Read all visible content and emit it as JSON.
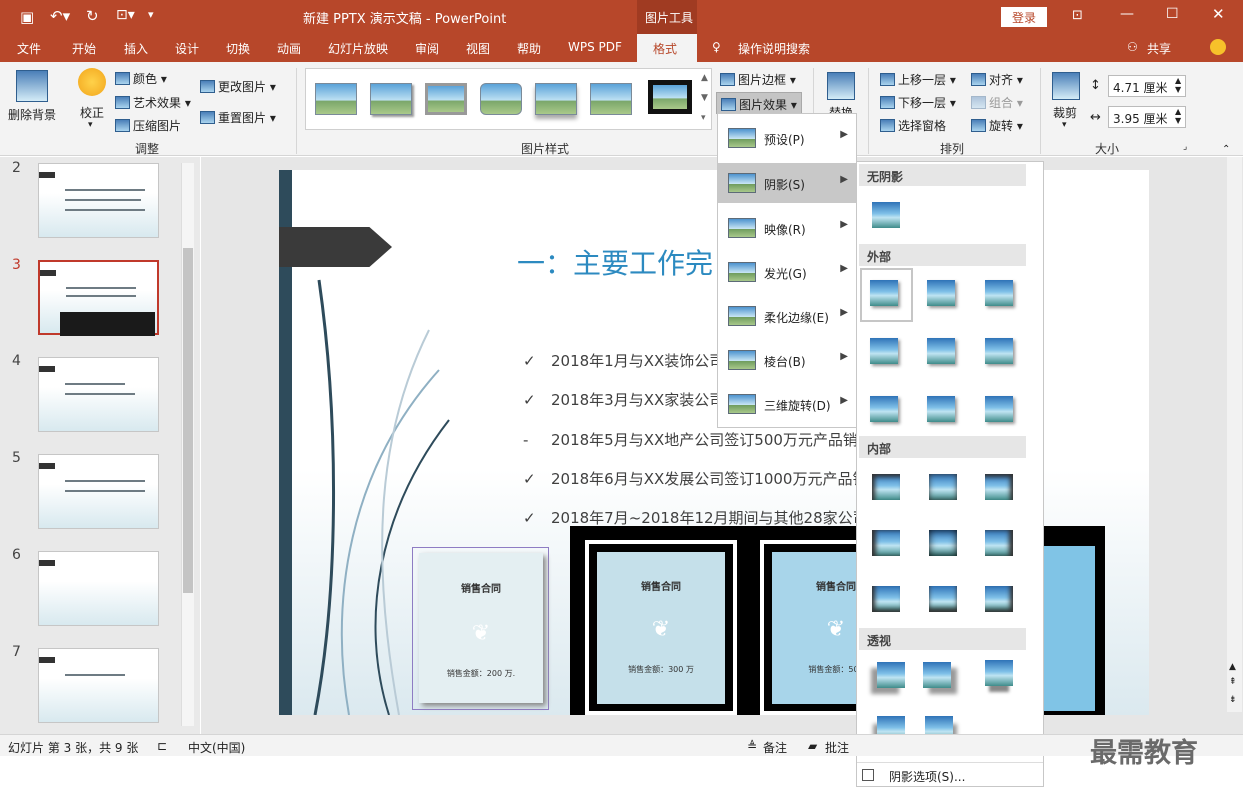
{
  "title": {
    "doc": "新建 PPTX 演示文稿 - PowerPoint",
    "tools": "图片工具",
    "login": "登录"
  },
  "tabs": [
    "文件",
    "开始",
    "插入",
    "设计",
    "切换",
    "动画",
    "幻灯片放映",
    "审阅",
    "视图",
    "帮助",
    "WPS PDF",
    "格式"
  ],
  "tell_me": "操作说明搜索",
  "share": "共享",
  "ribbon": {
    "remove_bg": "删除背景",
    "correct": "校正",
    "color": "颜色",
    "artistic": "艺术效果",
    "compress": "压缩图片",
    "change": "更改图片",
    "reset": "重置图片",
    "grp_adjust": "调整",
    "grp_styles": "图片样式",
    "border": "图片边框",
    "effects": "图片效果",
    "replace": "替换",
    "bring_forward": "上移一层",
    "send_backward": "下移一层",
    "selection_pane": "选择窗格",
    "align": "对齐",
    "group": "组合",
    "rotate": "旋转",
    "grp_arrange": "排列",
    "crop": "裁剪",
    "height": "4.71 厘米",
    "width": "3.95 厘米",
    "grp_size": "大小"
  },
  "thumbs": [
    "2",
    "3",
    "4",
    "5",
    "6",
    "7"
  ],
  "slide": {
    "heading": "一：主要工作完",
    "bullets": [
      {
        "m": "✓",
        "t": "2018年1月与XX装饰公司签"
      },
      {
        "m": "✓",
        "t": "2018年3月与XX家装公司签"
      },
      {
        "m": "-",
        "t": "2018年5月与XX地产公司签订500万元产品销售"
      },
      {
        "m": "✓",
        "t": "2018年6月与XX发展公司签订1000万元产品销"
      },
      {
        "m": "✓",
        "t": "2018年7月~2018年12月期间与其他28家公司签"
      }
    ],
    "card_title": "销售合同",
    "card1": "销售金额：200 万.",
    "card2": "销售金额：300 万",
    "card3": "销售金额：500"
  },
  "menu1": [
    {
      "label": "预设(P)"
    },
    {
      "label": "阴影(S)"
    },
    {
      "label": "映像(R)"
    },
    {
      "label": "发光(G)"
    },
    {
      "label": "柔化边缘(E)"
    },
    {
      "label": "棱台(B)"
    },
    {
      "label": "三维旋转(D)"
    }
  ],
  "menu2": {
    "no_shadow": "无阴影",
    "outer": "外部",
    "inner": "内部",
    "perspective": "透视",
    "options": "阴影选项(S)..."
  },
  "status": {
    "slide": "幻灯片 第 3 张，共 9 张",
    "lang": "中文(中国)",
    "notes": "备注",
    "comments": "批注"
  },
  "watermark": "最需教育"
}
